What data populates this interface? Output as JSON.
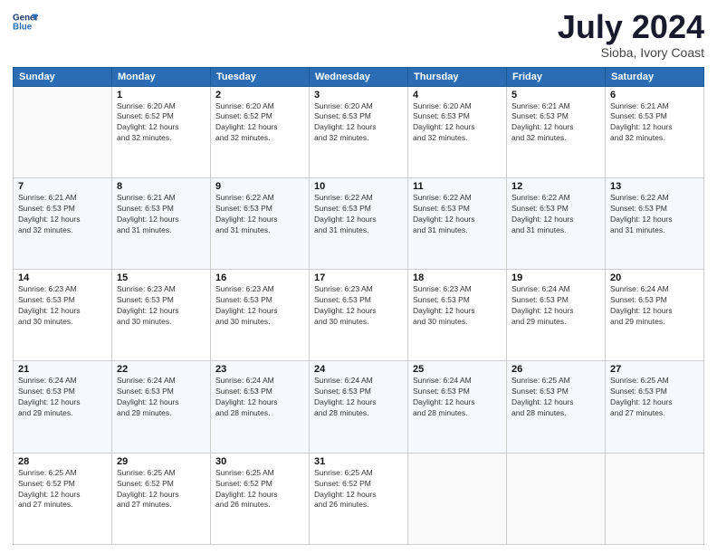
{
  "logo": {
    "text_general": "General",
    "text_blue": "Blue"
  },
  "header": {
    "month_title": "July 2024",
    "location": "Sioba, Ivory Coast"
  },
  "days_of_week": [
    "Sunday",
    "Monday",
    "Tuesday",
    "Wednesday",
    "Thursday",
    "Friday",
    "Saturday"
  ],
  "weeks": [
    [
      {
        "day": "",
        "info": ""
      },
      {
        "day": "1",
        "info": "Sunrise: 6:20 AM\nSunset: 6:52 PM\nDaylight: 12 hours\nand 32 minutes."
      },
      {
        "day": "2",
        "info": "Sunrise: 6:20 AM\nSunset: 6:52 PM\nDaylight: 12 hours\nand 32 minutes."
      },
      {
        "day": "3",
        "info": "Sunrise: 6:20 AM\nSunset: 6:53 PM\nDaylight: 12 hours\nand 32 minutes."
      },
      {
        "day": "4",
        "info": "Sunrise: 6:20 AM\nSunset: 6:53 PM\nDaylight: 12 hours\nand 32 minutes."
      },
      {
        "day": "5",
        "info": "Sunrise: 6:21 AM\nSunset: 6:53 PM\nDaylight: 12 hours\nand 32 minutes."
      },
      {
        "day": "6",
        "info": "Sunrise: 6:21 AM\nSunset: 6:53 PM\nDaylight: 12 hours\nand 32 minutes."
      }
    ],
    [
      {
        "day": "7",
        "info": "Sunrise: 6:21 AM\nSunset: 6:53 PM\nDaylight: 12 hours\nand 32 minutes."
      },
      {
        "day": "8",
        "info": "Sunrise: 6:21 AM\nSunset: 6:53 PM\nDaylight: 12 hours\nand 31 minutes."
      },
      {
        "day": "9",
        "info": "Sunrise: 6:22 AM\nSunset: 6:53 PM\nDaylight: 12 hours\nand 31 minutes."
      },
      {
        "day": "10",
        "info": "Sunrise: 6:22 AM\nSunset: 6:53 PM\nDaylight: 12 hours\nand 31 minutes."
      },
      {
        "day": "11",
        "info": "Sunrise: 6:22 AM\nSunset: 6:53 PM\nDaylight: 12 hours\nand 31 minutes."
      },
      {
        "day": "12",
        "info": "Sunrise: 6:22 AM\nSunset: 6:53 PM\nDaylight: 12 hours\nand 31 minutes."
      },
      {
        "day": "13",
        "info": "Sunrise: 6:22 AM\nSunset: 6:53 PM\nDaylight: 12 hours\nand 31 minutes."
      }
    ],
    [
      {
        "day": "14",
        "info": "Sunrise: 6:23 AM\nSunset: 6:53 PM\nDaylight: 12 hours\nand 30 minutes."
      },
      {
        "day": "15",
        "info": "Sunrise: 6:23 AM\nSunset: 6:53 PM\nDaylight: 12 hours\nand 30 minutes."
      },
      {
        "day": "16",
        "info": "Sunrise: 6:23 AM\nSunset: 6:53 PM\nDaylight: 12 hours\nand 30 minutes."
      },
      {
        "day": "17",
        "info": "Sunrise: 6:23 AM\nSunset: 6:53 PM\nDaylight: 12 hours\nand 30 minutes."
      },
      {
        "day": "18",
        "info": "Sunrise: 6:23 AM\nSunset: 6:53 PM\nDaylight: 12 hours\nand 30 minutes."
      },
      {
        "day": "19",
        "info": "Sunrise: 6:24 AM\nSunset: 6:53 PM\nDaylight: 12 hours\nand 29 minutes."
      },
      {
        "day": "20",
        "info": "Sunrise: 6:24 AM\nSunset: 6:53 PM\nDaylight: 12 hours\nand 29 minutes."
      }
    ],
    [
      {
        "day": "21",
        "info": "Sunrise: 6:24 AM\nSunset: 6:53 PM\nDaylight: 12 hours\nand 29 minutes."
      },
      {
        "day": "22",
        "info": "Sunrise: 6:24 AM\nSunset: 6:53 PM\nDaylight: 12 hours\nand 29 minutes."
      },
      {
        "day": "23",
        "info": "Sunrise: 6:24 AM\nSunset: 6:53 PM\nDaylight: 12 hours\nand 28 minutes."
      },
      {
        "day": "24",
        "info": "Sunrise: 6:24 AM\nSunset: 6:53 PM\nDaylight: 12 hours\nand 28 minutes."
      },
      {
        "day": "25",
        "info": "Sunrise: 6:24 AM\nSunset: 6:53 PM\nDaylight: 12 hours\nand 28 minutes."
      },
      {
        "day": "26",
        "info": "Sunrise: 6:25 AM\nSunset: 6:53 PM\nDaylight: 12 hours\nand 28 minutes."
      },
      {
        "day": "27",
        "info": "Sunrise: 6:25 AM\nSunset: 6:53 PM\nDaylight: 12 hours\nand 27 minutes."
      }
    ],
    [
      {
        "day": "28",
        "info": "Sunrise: 6:25 AM\nSunset: 6:52 PM\nDaylight: 12 hours\nand 27 minutes."
      },
      {
        "day": "29",
        "info": "Sunrise: 6:25 AM\nSunset: 6:52 PM\nDaylight: 12 hours\nand 27 minutes."
      },
      {
        "day": "30",
        "info": "Sunrise: 6:25 AM\nSunset: 6:52 PM\nDaylight: 12 hours\nand 26 minutes."
      },
      {
        "day": "31",
        "info": "Sunrise: 6:25 AM\nSunset: 6:52 PM\nDaylight: 12 hours\nand 26 minutes."
      },
      {
        "day": "",
        "info": ""
      },
      {
        "day": "",
        "info": ""
      },
      {
        "day": "",
        "info": ""
      }
    ]
  ]
}
